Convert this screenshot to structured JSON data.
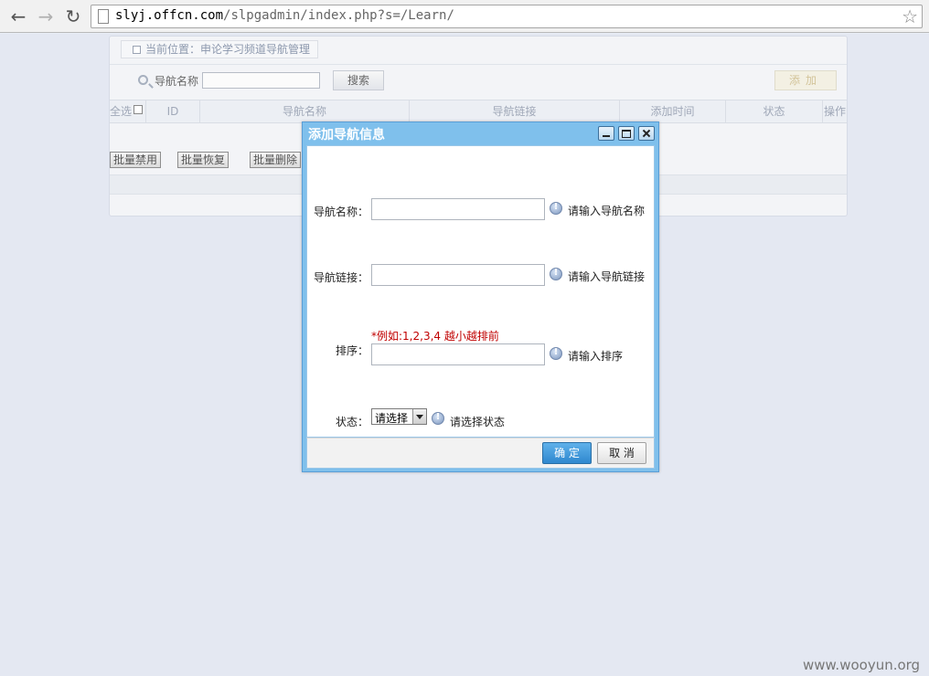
{
  "browser": {
    "url_host": "slyj.offcn.com",
    "url_path": "/slpgadmin/index.php?s=/Learn/"
  },
  "page": {
    "breadcrumb": "当前位置：申论学习频道导航管理",
    "search_label": "导航名称",
    "search_button": "搜索",
    "add_button": "添加",
    "table_headers": [
      "全选",
      "ID",
      "导航名称",
      "导航链接",
      "添加时间",
      "状态",
      "操作"
    ],
    "batch_buttons": [
      "批量禁用",
      "批量恢复",
      "批量删除"
    ]
  },
  "dialog": {
    "title": "添加导航信息",
    "fields": [
      {
        "label": "导航名称：",
        "hint": "请输入导航名称"
      },
      {
        "label": "导航链接：",
        "hint": "请输入导航链接"
      },
      {
        "label": "排序：",
        "hint": "请输入排序"
      },
      {
        "label": "状态：",
        "hint": "请选择状态"
      }
    ],
    "sort_example": "*例如:1,2,3,4 越小越排前",
    "status_select_value": "请选择",
    "ok_button": "确 定",
    "cancel_button": "取 消"
  },
  "watermark": "www.wooyun.org"
}
